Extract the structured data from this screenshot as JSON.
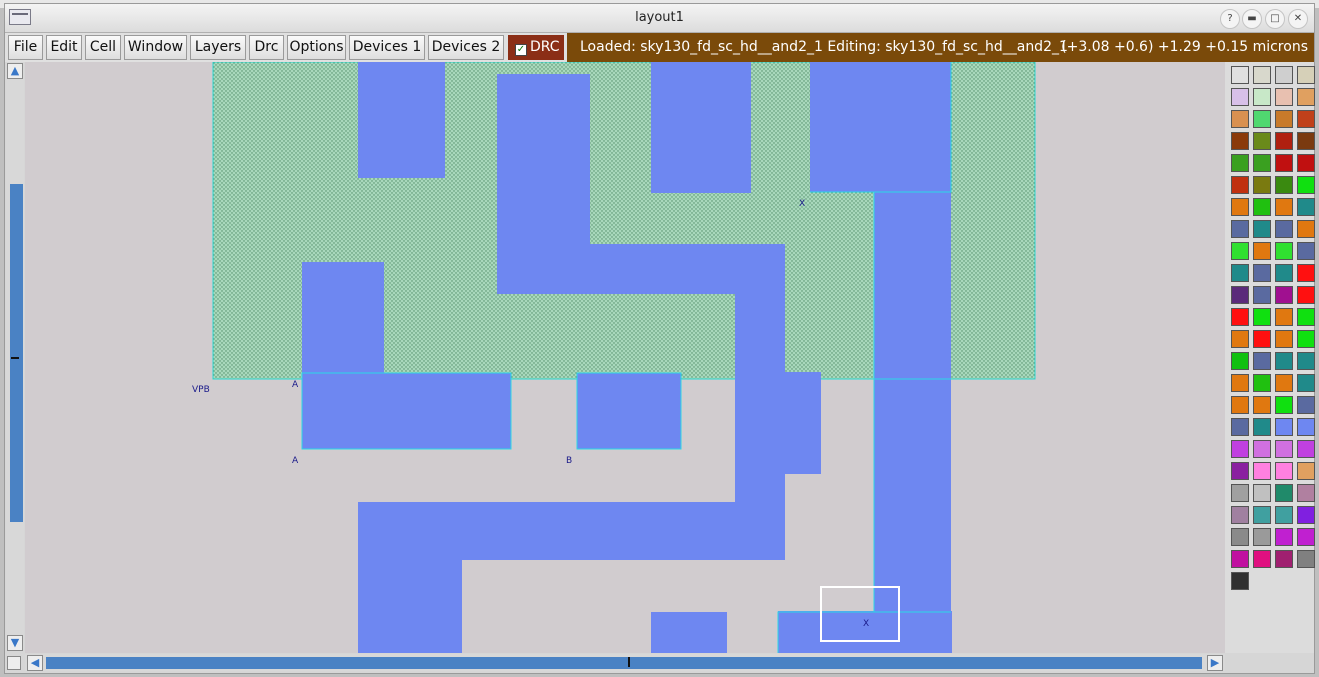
{
  "window": {
    "title": "layout1",
    "buttons": {
      "help": "?",
      "minimize": "▬",
      "maximize": "□",
      "close": "✕"
    }
  },
  "menu": {
    "items": [
      "File",
      "Edit",
      "Cell",
      "Window",
      "Layers",
      "Drc",
      "Options",
      "Devices 1",
      "Devices 2"
    ],
    "drc_label": "DRC",
    "drc_checked": true
  },
  "status": {
    "loaded_text": "Loaded: sky130_fd_sc_hd__and2_1 Editing: sky130_fd_sc_hd__and2_1",
    "coords_text": "(+3.08 +0.6) +1.29 +0.15 microns"
  },
  "layout": {
    "labels": [
      "VPB",
      "A",
      "A",
      "B",
      "X",
      "X"
    ],
    "colors": {
      "background": "#d1cccf",
      "nwell": "#a8d8bc",
      "nwell_dots": "#4f8a66",
      "nwell_outline": "#2ad8d0",
      "metal": "#6e87f1",
      "metal_outline": "#2ad8e6",
      "label": "#1a1a8a",
      "box": "#ffffff"
    }
  },
  "palette": {
    "swatches": [
      "#e0e0e0",
      "#d8d8cc",
      "#cfcfcf",
      "#d6d0b8",
      "#d8c0e8",
      "#c8e8c8",
      "#e8c0b0",
      "#e0a060",
      "#d89050",
      "#50d870",
      "#c87a2a",
      "#c0401a",
      "#8a3a0a",
      "#6a8a1a",
      "#b02010",
      "#7a3a10",
      "#3aa020",
      "#3aa020",
      "#c01010",
      "#c01010",
      "#c03010",
      "#7a7a10",
      "#3a8a10",
      "#10e010",
      "#e07810",
      "#20c010",
      "#e07810",
      "#208a8a",
      "#5a6aa0",
      "#208a8a",
      "#5a6aa0",
      "#e07810",
      "#30e030",
      "#e07810",
      "#30e030",
      "#5a6aa0",
      "#208a8a",
      "#5a6aa0",
      "#208a8a",
      "#ff1010",
      "#5a2a7a",
      "#5a6aa0",
      "#a01090",
      "#ff1010",
      "#ff1010",
      "#10e010",
      "#e07810",
      "#10e010",
      "#e07810",
      "#ff1010",
      "#e07810",
      "#10e010",
      "#10c010",
      "#5a6aa0",
      "#208a8a",
      "#208a8a",
      "#e07810",
      "#20c010",
      "#e07810",
      "#208a8a",
      "#e07810",
      "#e07810",
      "#10e010",
      "#5a6aa0",
      "#5a6aa0",
      "#208a8a",
      "#6e87f1",
      "#6e87f1",
      "#c040e0",
      "#d070e0",
      "#d070e0",
      "#c040e0",
      "#8a20a0",
      "#ff80e0",
      "#ff80e0",
      "#e0a060",
      "#a0a0a0",
      "#c0c0c0",
      "#208a6a",
      "#b080a0",
      "#a080a0",
      "#40a0a0",
      "#40a0a0",
      "#8020e0",
      "#8a8a8a",
      "#9a9a9a",
      "#c020d0",
      "#c020d0",
      "#c010a0",
      "#e01080",
      "#a02070",
      "#808080",
      "#303030"
    ]
  }
}
